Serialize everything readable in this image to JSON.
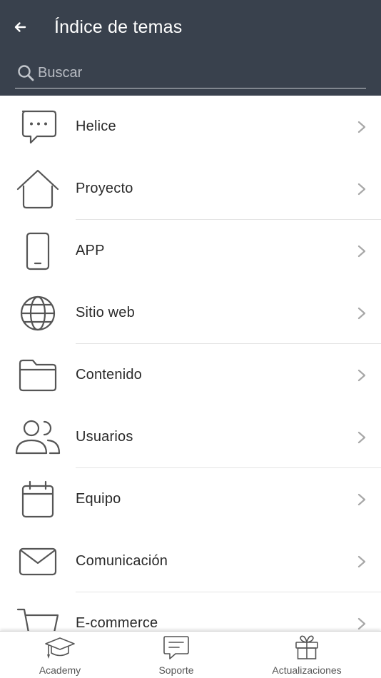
{
  "header": {
    "title": "Índice de temas",
    "back_icon": "arrow-left-icon",
    "background": "#39414d"
  },
  "search": {
    "placeholder": "Buscar",
    "icon": "search-icon"
  },
  "topics": [
    {
      "label": "Helice",
      "icon": "chat-bubble-icon"
    },
    {
      "label": "Proyecto",
      "icon": "home-icon"
    },
    {
      "label": "APP",
      "icon": "smartphone-icon"
    },
    {
      "label": "Sitio web",
      "icon": "globe-icon"
    },
    {
      "label": "Contenido",
      "icon": "folder-icon"
    },
    {
      "label": "Usuarios",
      "icon": "users-icon"
    },
    {
      "label": "Equipo",
      "icon": "calendar-icon"
    },
    {
      "label": "Comunicación",
      "icon": "envelope-icon"
    },
    {
      "label": "E-commerce",
      "icon": "shopping-cart-icon"
    }
  ],
  "tabbar": {
    "academy": {
      "label": "Academy",
      "icon": "graduation-cap-icon"
    },
    "soporte": {
      "label": "Soporte",
      "icon": "message-square-icon"
    },
    "actualizaciones": {
      "label": "Actualizaciones",
      "icon": "gift-icon"
    }
  }
}
